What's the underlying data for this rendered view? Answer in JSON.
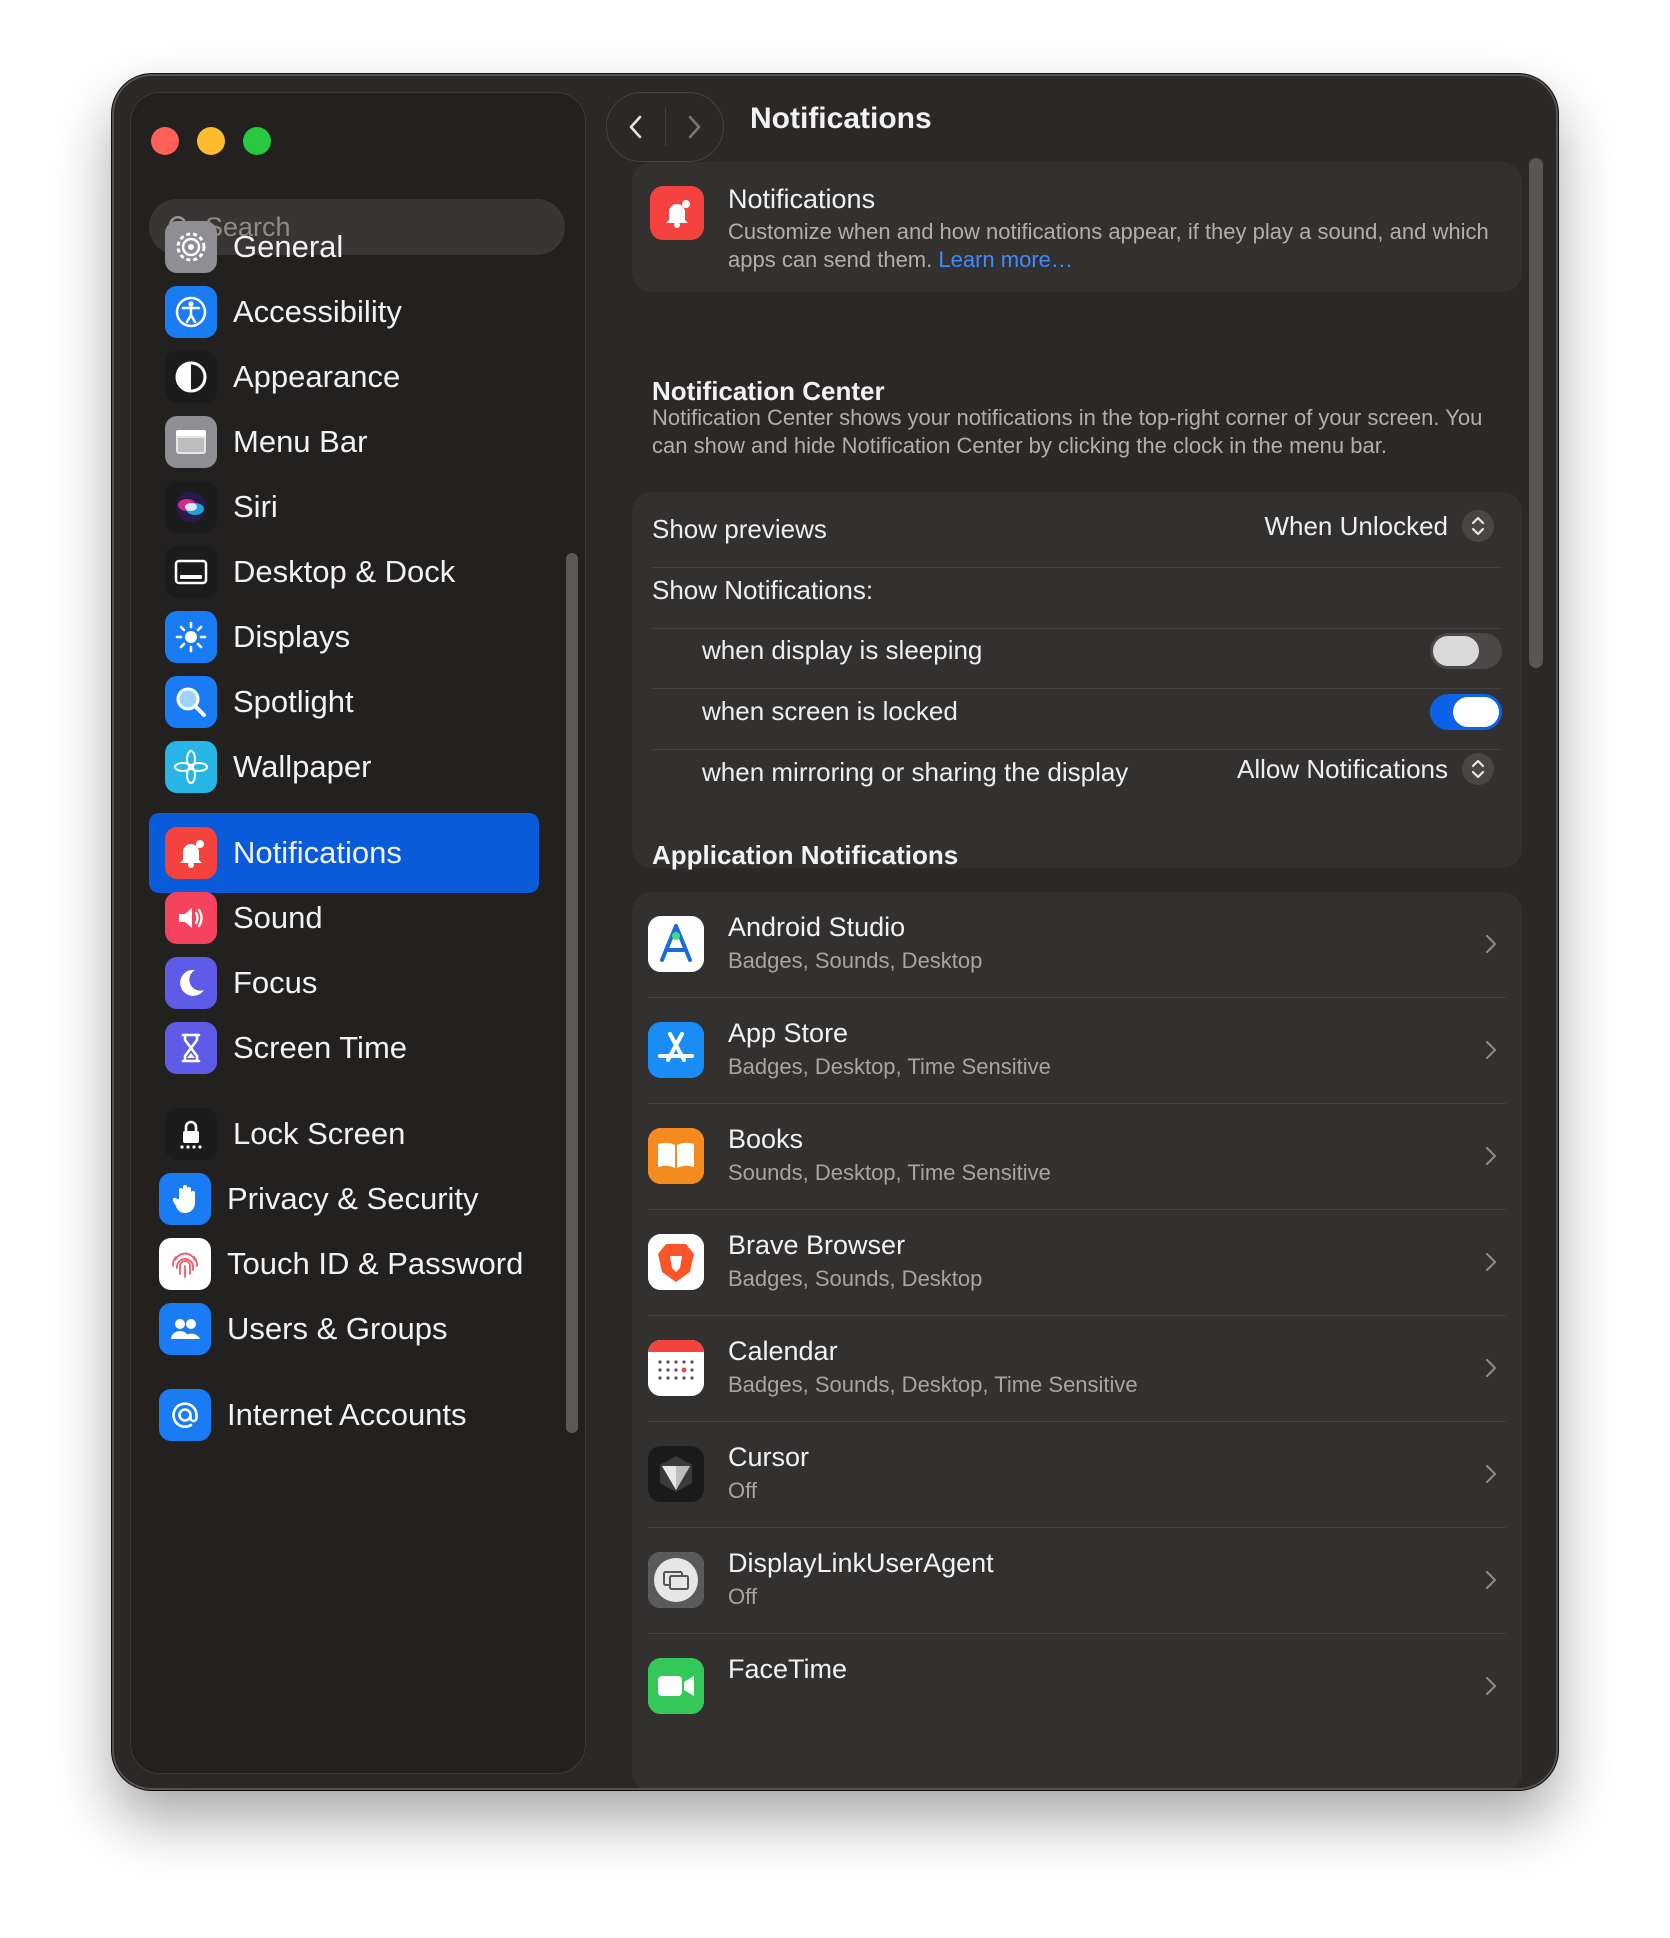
{
  "window": {
    "title": "Notifications"
  },
  "sidebar": {
    "search_placeholder": "Search",
    "items": [
      {
        "label": "General",
        "icon": "gear-icon",
        "color": "#8e8e93"
      },
      {
        "label": "Accessibility",
        "icon": "accessibility-icon",
        "color": "#1a7cf5"
      },
      {
        "label": "Appearance",
        "icon": "appearance-icon",
        "color": "#1c1c1e"
      },
      {
        "label": "Menu Bar",
        "icon": "menu-bar-icon",
        "color": "#8e8e93"
      },
      {
        "label": "Siri",
        "icon": "siri-icon",
        "color": "#8a2be2"
      },
      {
        "label": "Desktop & Dock",
        "icon": "dock-icon",
        "color": "#1c1c1e"
      },
      {
        "label": "Displays",
        "icon": "sun-icon",
        "color": "#1a7cf5"
      },
      {
        "label": "Spotlight",
        "icon": "magnifier-icon",
        "color": "#1a7cf5"
      },
      {
        "label": "Wallpaper",
        "icon": "flower-icon",
        "color": "#28b6e8"
      },
      {
        "label": "Notifications",
        "icon": "bell-icon",
        "color": "#f4423f",
        "active": true
      },
      {
        "label": "Sound",
        "icon": "speaker-icon",
        "color": "#f4425f"
      },
      {
        "label": "Focus",
        "icon": "moon-icon",
        "color": "#5e5ce6"
      },
      {
        "label": "Screen Time",
        "icon": "hourglass-icon",
        "color": "#5e5ce6"
      },
      {
        "label": "Lock Screen",
        "icon": "lock-icon",
        "color": "#1c1c1e"
      },
      {
        "label": "Privacy & Security",
        "icon": "hand-icon",
        "color": "#1a7cf5"
      },
      {
        "label": "Touch ID & Password",
        "icon": "fingerprint-icon",
        "color": "#ffffff"
      },
      {
        "label": "Users & Groups",
        "icon": "users-icon",
        "color": "#1a7cf5"
      },
      {
        "label": "Internet Accounts",
        "icon": "at-icon",
        "color": "#1a7cf5"
      }
    ]
  },
  "intro": {
    "title": "Notifications",
    "description": "Customize when and how notifications appear, if they play a sound, and which apps can send them.",
    "learn_more": "Learn more…"
  },
  "notification_center": {
    "title": "Notification Center",
    "description": "Notification Center shows your notifications in the top-right corner of your screen. You can show and hide Notification Center by clicking the clock in the menu bar.",
    "show_previews_label": "Show previews",
    "show_previews_value": "When Unlocked",
    "show_notifications_label": "Show Notifications:",
    "sleeping_label": "when display is sleeping",
    "sleeping_on": false,
    "locked_label": "when screen is locked",
    "locked_on": true,
    "mirroring_label": "when mirroring or sharing the display",
    "mirroring_value": "Allow Notifications"
  },
  "app_notifications": {
    "title": "Application Notifications",
    "apps": [
      {
        "name": "Android Studio",
        "summary": "Badges, Sounds, Desktop",
        "icon": "android-studio-icon"
      },
      {
        "name": "App Store",
        "summary": "Badges, Desktop, Time Sensitive",
        "icon": "app-store-icon"
      },
      {
        "name": "Books",
        "summary": "Sounds, Desktop, Time Sensitive",
        "icon": "books-icon"
      },
      {
        "name": "Brave Browser",
        "summary": "Badges, Sounds, Desktop",
        "icon": "brave-icon"
      },
      {
        "name": "Calendar",
        "summary": "Badges, Sounds, Desktop, Time Sensitive",
        "icon": "calendar-icon"
      },
      {
        "name": "Cursor",
        "summary": "Off",
        "icon": "cursor-icon"
      },
      {
        "name": "DisplayLinkUserAgent",
        "summary": "Off",
        "icon": "displaylink-icon"
      },
      {
        "name": "FaceTime",
        "summary": "",
        "icon": "facetime-icon"
      }
    ]
  }
}
